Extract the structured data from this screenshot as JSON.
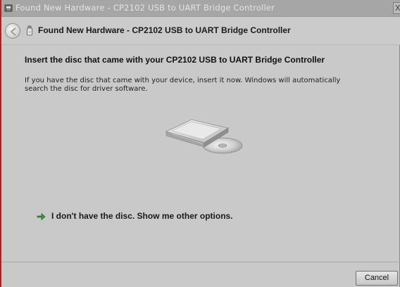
{
  "window": {
    "title": "Found New Hardware - CP2102 USB to UART Bridge Controller",
    "close_glyph": "X"
  },
  "navbar": {
    "title": "Found New Hardware - CP2102 USB to UART Bridge Controller"
  },
  "content": {
    "heading": "Insert the disc that came with your CP2102 USB to UART Bridge Controller",
    "description": "If you have the disc that came with your device, insert it now.  Windows will automatically search the disc for driver software.",
    "option_link": "I don't have the disc.  Show me other options."
  },
  "footer": {
    "cancel_label": "Cancel"
  },
  "icons": {
    "title_icon": "hardware-wizard-icon",
    "back": "back-arrow-icon",
    "nav_icon": "usb-device-icon",
    "option_arrow": "green-arrow-icon",
    "illustration": "disc-drive-illustration"
  },
  "colors": {
    "window_border": "#b31f1f",
    "option_arrow": "#2e9e2e"
  }
}
